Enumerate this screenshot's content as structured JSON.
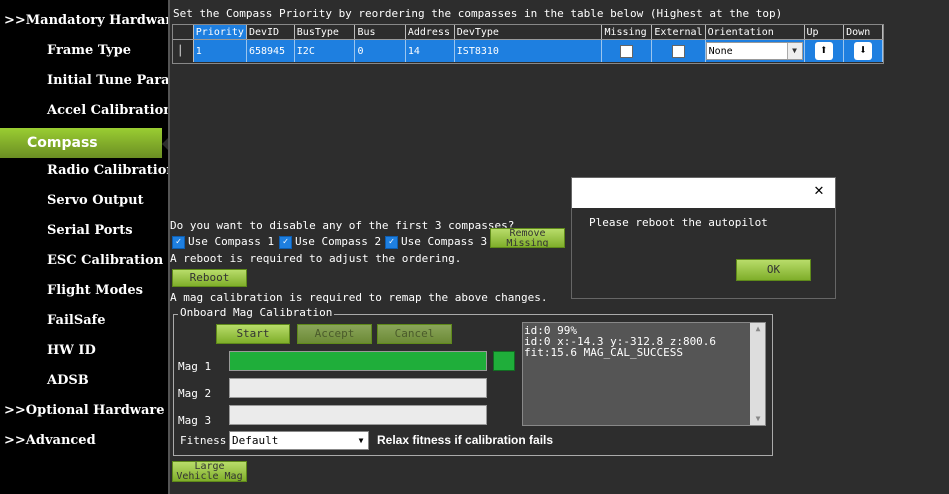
{
  "sidebar": {
    "items": [
      {
        "label": ">>Mandatory Hardware",
        "level": "top"
      },
      {
        "label": "Frame Type",
        "level": "sub"
      },
      {
        "label": "Initial Tune Parameters",
        "level": "sub"
      },
      {
        "label": "Accel Calibration",
        "level": "sub"
      },
      {
        "label": "Compass",
        "level": "active"
      },
      {
        "label": "Radio Calibration",
        "level": "sub"
      },
      {
        "label": "Servo Output",
        "level": "sub"
      },
      {
        "label": "Serial Ports",
        "level": "sub"
      },
      {
        "label": "ESC Calibration",
        "level": "sub"
      },
      {
        "label": "Flight Modes",
        "level": "sub"
      },
      {
        "label": "FailSafe",
        "level": "sub"
      },
      {
        "label": "HW ID",
        "level": "sub"
      },
      {
        "label": "ADSB",
        "level": "sub"
      },
      {
        "label": ">>Optional Hardware",
        "level": "top"
      },
      {
        "label": ">>Advanced",
        "level": "top"
      }
    ]
  },
  "compass": {
    "priority_instruction": "Set the Compass Priority by reordering the compasses in the table below (Highest at the top)",
    "table": {
      "headers": [
        "Priority",
        "DevID",
        "BusType",
        "Bus",
        "Address",
        "DevType",
        "Missing",
        "External",
        "Orientation",
        "Up",
        "Down"
      ],
      "row": {
        "priority": "1",
        "devid": "658945",
        "bustype": "I2C",
        "bus": "0",
        "address": "14",
        "devtype": "IST8310",
        "orientation": "None"
      }
    },
    "disable_question": "Do you want to disable any of the first 3 compasses?",
    "use_compass_1": "Use Compass 1",
    "use_compass_2": "Use Compass 2",
    "use_compass_3": "Use Compass 3",
    "remove_missing_label": "Remove Missing",
    "reboot_note": "A reboot is required to adjust the ordering.",
    "reboot_label": "Reboot",
    "mag_cal_note": "A mag calibration is required to remap the above changes.",
    "onboard": {
      "title": "Onboard Mag Calibration",
      "start_label": "Start",
      "accept_label": "Accept",
      "cancel_label": "Cancel",
      "mag1_label": "Mag 1",
      "mag2_label": "Mag 2",
      "mag3_label": "Mag 3",
      "mag1_progress": 1.0,
      "mag2_progress": 0,
      "mag3_progress": 0,
      "log_lines": [
        "id:0 99%",
        "id:0 x:-14.3 y:-312.8 z:800.6",
        "fit:15.6 MAG_CAL_SUCCESS"
      ],
      "fitness_label": "Fitness",
      "fitness_value": "Default",
      "relax_label": "Relax fitness if calibration fails"
    },
    "large_vehicle_label": "Large Vehicle Mag"
  },
  "dialog": {
    "message": "Please reboot the autopilot",
    "ok_label": "OK"
  },
  "colors": {
    "accent_green": "#9acd32",
    "selection_blue": "#1e7fe0",
    "progress_green": "#1fae3a"
  }
}
